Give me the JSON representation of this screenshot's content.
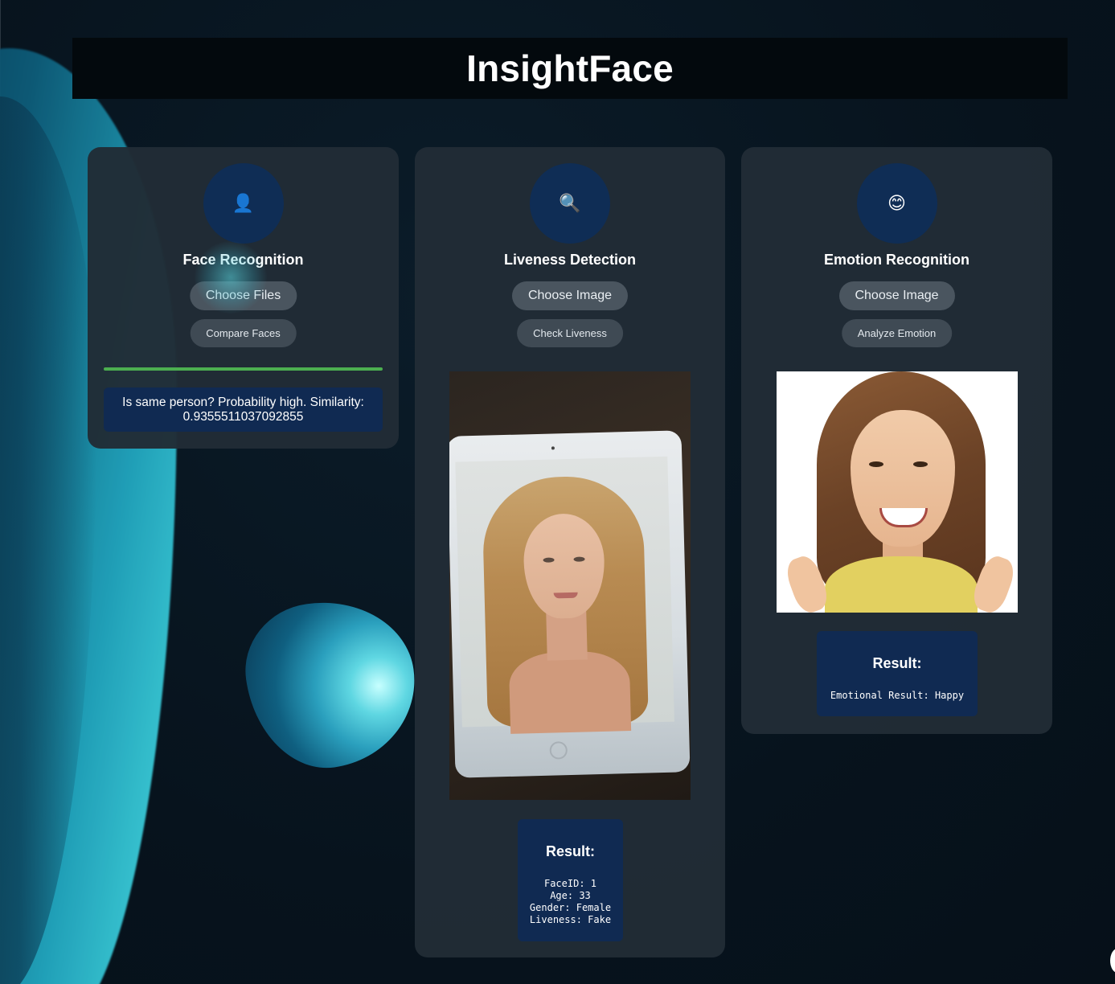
{
  "app": {
    "title": "InsightFace"
  },
  "cards": {
    "face_recognition": {
      "icon": "person-icon",
      "icon_glyph": "👤",
      "title": "Face Recognition",
      "choose_label": "Choose Files",
      "action_label": "Compare Faces",
      "progress": 1.0,
      "progress_color": "#4caf50",
      "result_text": "Is same person? Probability high. Similarity: 0.9355511037092855"
    },
    "liveness_detection": {
      "icon": "magnifier-icon",
      "icon_glyph": "🔍",
      "title": "Liveness Detection",
      "choose_label": "Choose Image",
      "action_label": "Check Liveness",
      "result_title": "Result:",
      "result_lines": [
        "FaceID: 1",
        "Age: 33",
        "Gender: Female",
        "Liveness: Fake"
      ]
    },
    "emotion_recognition": {
      "icon": "smiley-icon",
      "icon_glyph": "😊",
      "title": "Emotion Recognition",
      "choose_label": "Choose Image",
      "action_label": "Analyze Emotion",
      "result_title": "Result:",
      "result_lines": [
        "Emotional Result: Happy"
      ]
    }
  },
  "colors": {
    "background": "#07141f",
    "header": "#03090d",
    "card": "#212c36",
    "icon_circle": "#0f2d55",
    "result_box": "#102a52",
    "button": "#4a555f"
  }
}
